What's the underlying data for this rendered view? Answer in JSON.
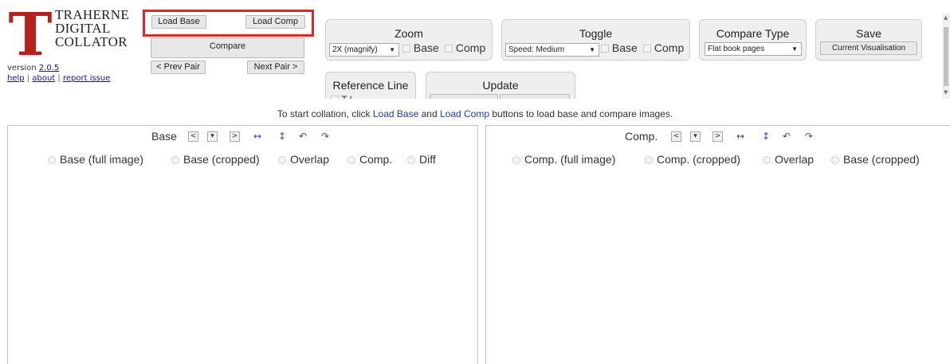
{
  "logo": {
    "letter": "T",
    "line1": "TRAHERNE",
    "line2": "DIGITAL",
    "line3": "COLLATOR",
    "color": "#b3231c"
  },
  "version": {
    "prefix": "version",
    "number": "2.0.5"
  },
  "links": {
    "help": "help",
    "about": "about",
    "report": "report issue",
    "sep": "|"
  },
  "buttons": {
    "load_base": "Load Base",
    "load_comp": "Load Comp",
    "compare": "Compare",
    "prev_pair": "< Prev Pair",
    "next_pair": "Next Pair >"
  },
  "zoom": {
    "title": "Zoom",
    "select_value": "2X (magnify)",
    "cb_base": "Base",
    "cb_comp": "Comp"
  },
  "toggle": {
    "title": "Toggle",
    "select_value": "Speed: Medium",
    "cb_base": "Base",
    "cb_comp": "Comp"
  },
  "compare_type": {
    "title": "Compare Type",
    "select_value": "Flat book pages"
  },
  "save": {
    "title": "Save",
    "button": "Current Visualisation"
  },
  "reference_line": {
    "title": "Reference Line",
    "cb_partial": "T    l"
  },
  "update": {
    "title": "Update"
  },
  "status": {
    "pre": "To start collation, click",
    "kw1": "Load Base",
    "mid": "and",
    "kw2": "Load Comp",
    "post": "buttons to load base and compare images."
  },
  "base_panel": {
    "title": "Base",
    "nav_prev": "<",
    "nav_menu": "▾",
    "nav_next": ">",
    "icons": [
      "flip-horizontal-icon",
      "flip-vertical-icon",
      "rotate-left-icon",
      "rotate-right-icon"
    ],
    "radios": [
      "Base (full image)",
      "Base (cropped)",
      "Overlap",
      "Comp.",
      "Diff"
    ]
  },
  "comp_panel": {
    "title": "Comp.",
    "nav_prev": "<",
    "nav_menu": "▾",
    "nav_next": ">",
    "icons": [
      "flip-horizontal-icon",
      "flip-vertical-icon",
      "rotate-left-icon",
      "rotate-right-icon"
    ],
    "radios": [
      "Comp. (full image)",
      "Comp. (cropped)",
      "Overlap",
      "Base (cropped)"
    ]
  },
  "colors": {
    "highlight": "#d42a2a",
    "accent_text": "#2a3a9a",
    "link": "#1a0dab"
  }
}
